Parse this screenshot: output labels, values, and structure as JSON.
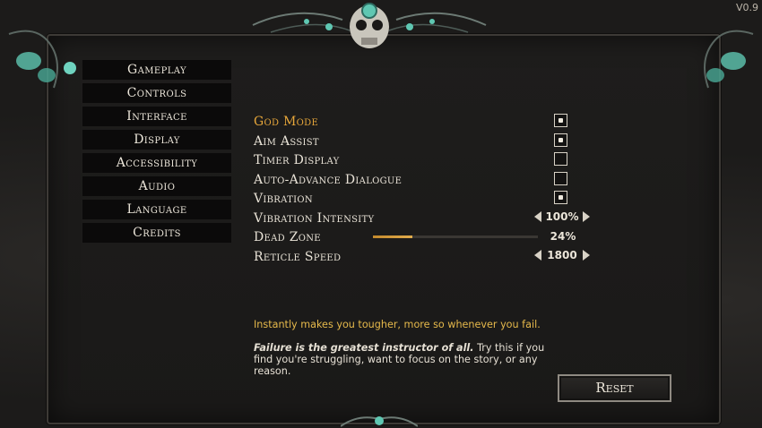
{
  "version": "V0.9",
  "menu": [
    "Gameplay",
    "Controls",
    "Interface",
    "Display",
    "Accessibility",
    "Audio",
    "Language",
    "Credits"
  ],
  "settings": [
    {
      "label": "God Mode",
      "type": "checkbox",
      "checked": true,
      "selected": true
    },
    {
      "label": "Aim Assist",
      "type": "checkbox",
      "checked": true
    },
    {
      "label": "Timer Display",
      "type": "checkbox",
      "checked": false
    },
    {
      "label": "Auto-Advance Dialogue",
      "type": "checkbox",
      "checked": false
    },
    {
      "label": "Vibration",
      "type": "checkbox",
      "checked": true
    },
    {
      "label": "Vibration Intensity",
      "type": "stepper",
      "value": "100%"
    },
    {
      "label": "Dead Zone",
      "type": "slider",
      "value": "24%",
      "fraction": 0.24
    },
    {
      "label": "Reticle Speed",
      "type": "stepper",
      "value": "1800"
    }
  ],
  "description": "Instantly makes you tougher, more so whenever you fail.",
  "quote_bold": "Failure is the greatest instructor of all.",
  "quote_rest": " Try this if you find you're struggling, want to focus on the story, or any reason.",
  "reset_label": "Reset",
  "colors": {
    "accent": "#e6a63a",
    "ornament": "#5fc7b2"
  }
}
